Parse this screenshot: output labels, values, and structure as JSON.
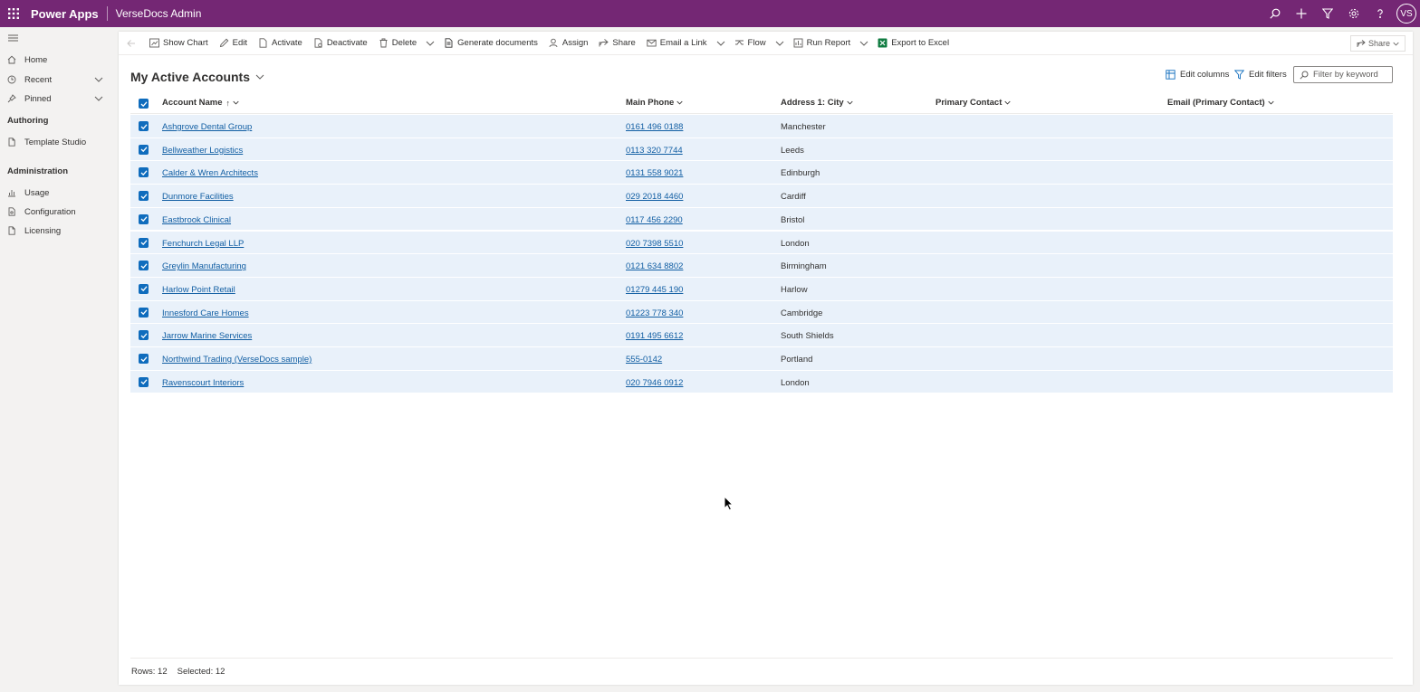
{
  "app": {
    "name": "Power Apps",
    "environment": "VerseDocs Admin",
    "user_initials": "VS"
  },
  "sidebar": {
    "items_top": [
      {
        "label": "Home",
        "icon": "home-icon"
      },
      {
        "label": "Recent",
        "icon": "clock-icon"
      },
      {
        "label": "Pinned",
        "icon": "pin-icon"
      }
    ],
    "authoring_header": "Authoring",
    "authoring_items": [
      {
        "label": "Template Studio",
        "icon": "document-icon"
      }
    ],
    "administration_header": "Administration",
    "administration_items": [
      {
        "label": "Usage",
        "icon": "bar-chart-icon"
      },
      {
        "label": "Configuration",
        "icon": "document-gear-icon"
      },
      {
        "label": "Licensing",
        "icon": "document-icon"
      }
    ]
  },
  "commands": {
    "show_chart": "Show Chart",
    "edit": "Edit",
    "activate": "Activate",
    "deactivate": "Deactivate",
    "delete": "Delete",
    "generate_documents": "Generate documents",
    "assign": "Assign",
    "share": "Share",
    "email_link": "Email a Link",
    "flow": "Flow",
    "run_report": "Run Report",
    "export_excel": "Export to Excel",
    "share_right": "Share"
  },
  "view": {
    "title": "My Active Accounts",
    "edit_columns": "Edit columns",
    "edit_filters": "Edit filters",
    "filter_placeholder": "Filter by keyword"
  },
  "grid": {
    "columns": [
      "Account Name",
      "Main Phone",
      "Address 1: City",
      "Primary Contact",
      "Email (Primary Contact)"
    ],
    "sort_indicator": "↑",
    "rows": [
      {
        "name": "Ashgrove Dental Group",
        "phone": "0161 496 0188",
        "city": "Manchester"
      },
      {
        "name": "Bellweather Logistics",
        "phone": "0113 320 7744",
        "city": "Leeds"
      },
      {
        "name": "Calder & Wren Architects",
        "phone": "0131 558 9021",
        "city": "Edinburgh"
      },
      {
        "name": "Dunmore Facilities",
        "phone": "029 2018 4460",
        "city": "Cardiff"
      },
      {
        "name": "Eastbrook Clinical",
        "phone": "0117 456 2290",
        "city": "Bristol"
      },
      {
        "name": "Fenchurch Legal LLP",
        "phone": "020 7398 5510",
        "city": "London"
      },
      {
        "name": "Greylin Manufacturing",
        "phone": "0121 634 8802",
        "city": "Birmingham"
      },
      {
        "name": "Harlow Point Retail",
        "phone": "01279 445 190",
        "city": "Harlow"
      },
      {
        "name": "Innesford Care Homes",
        "phone": "01223 778 340",
        "city": "Cambridge"
      },
      {
        "name": "Jarrow Marine Services",
        "phone": "0191 495 6612",
        "city": "South Shields"
      },
      {
        "name": "Northwind Trading (VerseDocs sample)",
        "phone": "555-0142",
        "city": "Portland"
      },
      {
        "name": "Ravenscourt Interiors",
        "phone": "020 7946 0912",
        "city": "London"
      }
    ]
  },
  "footer": {
    "rows": "Rows: 12",
    "selected": "Selected: 12"
  },
  "colors": {
    "topbar": "#742774",
    "accent": "#0f6cbd",
    "row_selected": "#e9f1fa",
    "link": "#115ea3"
  }
}
